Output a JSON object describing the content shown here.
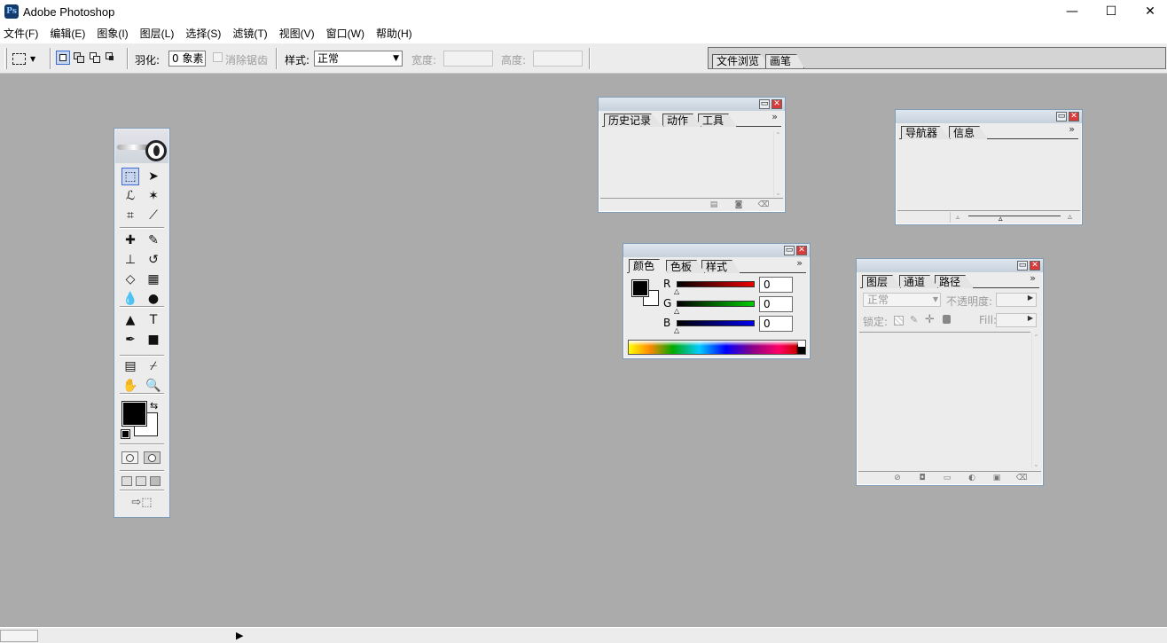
{
  "window": {
    "title": "Adobe Photoshop",
    "app_icon_letter": "Ps",
    "minimize": "—",
    "maximize": "☐",
    "close": "✕"
  },
  "menu": [
    "文件(F)",
    "编辑(E)",
    "图象(I)",
    "图层(L)",
    "选择(S)",
    "滤镜(T)",
    "视图(V)",
    "窗口(W)",
    "帮助(H)"
  ],
  "options": {
    "feather_label": "羽化:",
    "feather_value": "0 象素",
    "antialias_label": "消除锯齿",
    "style_label": "样式:",
    "style_value": "正常",
    "width_label": "宽度:",
    "height_label": "高度:"
  },
  "palette_well": {
    "tabs": [
      "文件浏览",
      "画笔"
    ]
  },
  "history_palette": {
    "tabs": [
      "历史记录",
      "动作",
      "工具"
    ],
    "more": "»"
  },
  "navigator_palette": {
    "tabs": [
      "导航器",
      "信息"
    ],
    "more": "»"
  },
  "color_palette": {
    "tabs": [
      "颜色",
      "色板",
      "样式"
    ],
    "more": "»",
    "channels": [
      {
        "label": "R",
        "value": "0",
        "color": "#d40000"
      },
      {
        "label": "G",
        "value": "0",
        "color": "#00a000"
      },
      {
        "label": "B",
        "value": "0",
        "color": "#0000c8"
      }
    ]
  },
  "layers_palette": {
    "tabs": [
      "图层",
      "通道",
      "路径"
    ],
    "more": "»",
    "blend_mode": "正常",
    "opacity_label": "不透明度:",
    "lock_label": "锁定:",
    "fill_label": "Fill:"
  },
  "toolbox": {
    "tools": [
      {
        "name": "marquee-tool",
        "glyph": "⬚"
      },
      {
        "name": "move-tool",
        "glyph": "➤"
      },
      {
        "name": "lasso-tool",
        "glyph": "ℒ"
      },
      {
        "name": "magic-wand-tool",
        "glyph": "✶"
      },
      {
        "name": "crop-tool",
        "glyph": "⌗"
      },
      {
        "name": "slice-tool",
        "glyph": "⟋"
      },
      {
        "name": "healing-brush-tool",
        "glyph": "✚"
      },
      {
        "name": "brush-tool",
        "glyph": "✎"
      },
      {
        "name": "clone-stamp-tool",
        "glyph": "⊥"
      },
      {
        "name": "history-brush-tool",
        "glyph": "↺"
      },
      {
        "name": "eraser-tool",
        "glyph": "◇"
      },
      {
        "name": "gradient-tool",
        "glyph": "▦"
      },
      {
        "name": "blur-tool",
        "glyph": "💧"
      },
      {
        "name": "dodge-tool",
        "glyph": "●"
      },
      {
        "name": "path-selection-tool",
        "glyph": "▲"
      },
      {
        "name": "type-tool",
        "glyph": "T"
      },
      {
        "name": "pen-tool",
        "glyph": "✒"
      },
      {
        "name": "shape-tool",
        "glyph": "■"
      },
      {
        "name": "notes-tool",
        "glyph": "▤"
      },
      {
        "name": "eyedropper-tool",
        "glyph": "⌿"
      },
      {
        "name": "hand-tool",
        "glyph": "✋"
      },
      {
        "name": "zoom-tool",
        "glyph": "🔍"
      }
    ]
  }
}
